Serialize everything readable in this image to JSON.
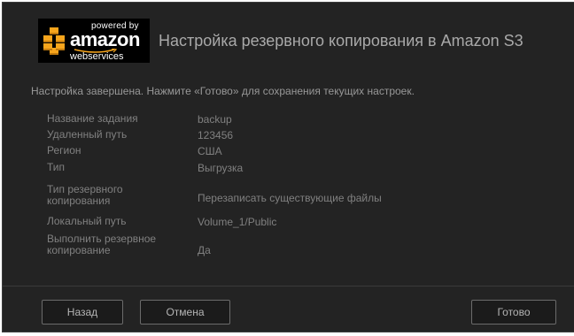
{
  "logo": {
    "powered": "powered by",
    "brand": "amazon",
    "sub": "webservices"
  },
  "dialog": {
    "title": "Настройка резервного копирования в Amazon S3",
    "status": "Настройка завершена. Нажмите «Готово» для сохранения текущих настроек."
  },
  "summary": [
    {
      "label": "Название задания",
      "value": "backup"
    },
    {
      "label": "Удаленный путь",
      "value": "123456"
    },
    {
      "label": "Регион",
      "value": "США"
    },
    {
      "label": "Тип",
      "value": "Выгрузка"
    },
    {
      "label": "Тип резервного копирования",
      "value": "Перезаписать существующие файлы"
    },
    {
      "label": "Локальный путь",
      "value": "Volume_1/Public"
    },
    {
      "label": "Выполнить резервное копирование",
      "value": "Да"
    }
  ],
  "buttons": {
    "back": "Назад",
    "cancel": "Отмена",
    "done": "Готово"
  },
  "colors": {
    "background": "#232323",
    "logo_orange": "#f7a51c",
    "text": "#808080"
  },
  "icons": {
    "logo_mark": "aws-cubes-icon"
  }
}
